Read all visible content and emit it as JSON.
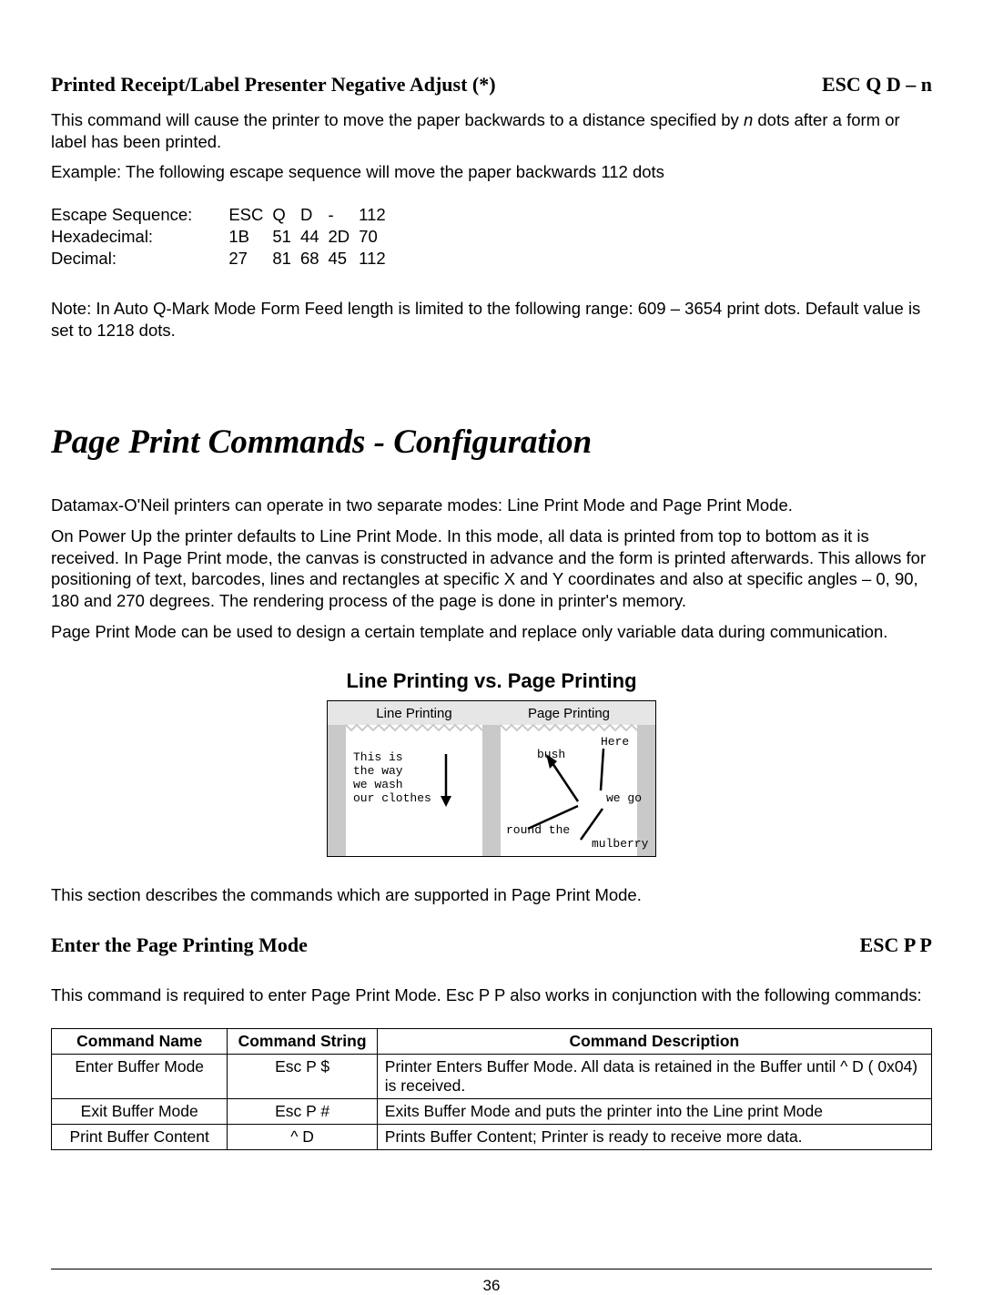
{
  "sec1": {
    "title_left": "Printed Receipt/Label Presenter Negative Adjust (*)",
    "title_right": "ESC Q D – n",
    "p1_a": "This command will cause the printer to move the paper backwards to a distance specified by ",
    "p1_n": "n",
    "p1_b": " dots after a form or label has been printed.",
    "p2": "Example: The following escape sequence will move the paper backwards 112 dots",
    "seq": {
      "r1": {
        "label": "Escape Sequence:",
        "c1": "ESC",
        "c2": "Q",
        "c3": "D",
        "c4": "-",
        "c5": "112"
      },
      "r2": {
        "label": "Hexadecimal:",
        "c1": "1B",
        "c2": "51",
        "c3": "44",
        "c4": "2D",
        "c5": "70"
      },
      "r3": {
        "label": "Decimal:",
        "c1": "27",
        "c2": "81",
        "c3": "68",
        "c4": "45",
        "c5": "112"
      }
    },
    "note": "Note: In Auto Q-Mark Mode Form Feed length is limited to the following range: 609 – 3654 print dots. Default value is set to 1218 dots."
  },
  "main_heading": "Page Print Commands - Configuration",
  "sec2": {
    "p1": "Datamax-O'Neil printers can operate in two separate modes: Line Print Mode and Page Print Mode.",
    "p2": "On Power Up the printer defaults to Line Print Mode. In this mode, all data is printed from top to bottom as it is received. In Page Print mode, the canvas is constructed in advance and the form is printed afterwards. This allows for positioning of text, barcodes, lines and rectangles at specific X and Y coordinates and also at specific angles – 0, 90, 180 and 270 degrees. The rendering process of the page is done in printer's memory.",
    "p3": "Page Print Mode can be used to design a certain template and replace only variable data during communication.",
    "sub_heading": "Line Printing vs. Page Printing",
    "diagram": {
      "left_title": "Line Printing",
      "right_title": "Page Printing",
      "left_l1": "This is",
      "left_l2": "the way",
      "left_l3": "we wash",
      "left_l4": "our clothes",
      "right_t1": "Here",
      "right_t2": "bush",
      "right_t3": "we go",
      "right_t4": "round the",
      "right_t5": "mulberry"
    },
    "p4": "This section describes the commands which are supported in Page Print Mode."
  },
  "sec3": {
    "title_left": "Enter the Page Printing Mode",
    "title_right": "ESC P P",
    "p1": "This command is required to enter Page Print Mode. Esc P P also works in conjunction with the following commands:",
    "headers": {
      "h1": "Command Name",
      "h2": "Command String",
      "h3": "Command Description"
    },
    "rows": {
      "r1": {
        "name": "Enter Buffer Mode",
        "string": "Esc  P $",
        "desc": "Printer Enters Buffer Mode. All data is retained in the Buffer until ^ D ( 0x04) is received."
      },
      "r2": {
        "name": "Exit Buffer Mode",
        "string": "Esc P #",
        "desc": "Exits Buffer Mode and puts the printer into the Line print Mode"
      },
      "r3": {
        "name": "Print Buffer Content",
        "string": "^ D",
        "desc": "Prints Buffer Content; Printer is ready to receive more data."
      }
    }
  },
  "page_number": "36"
}
